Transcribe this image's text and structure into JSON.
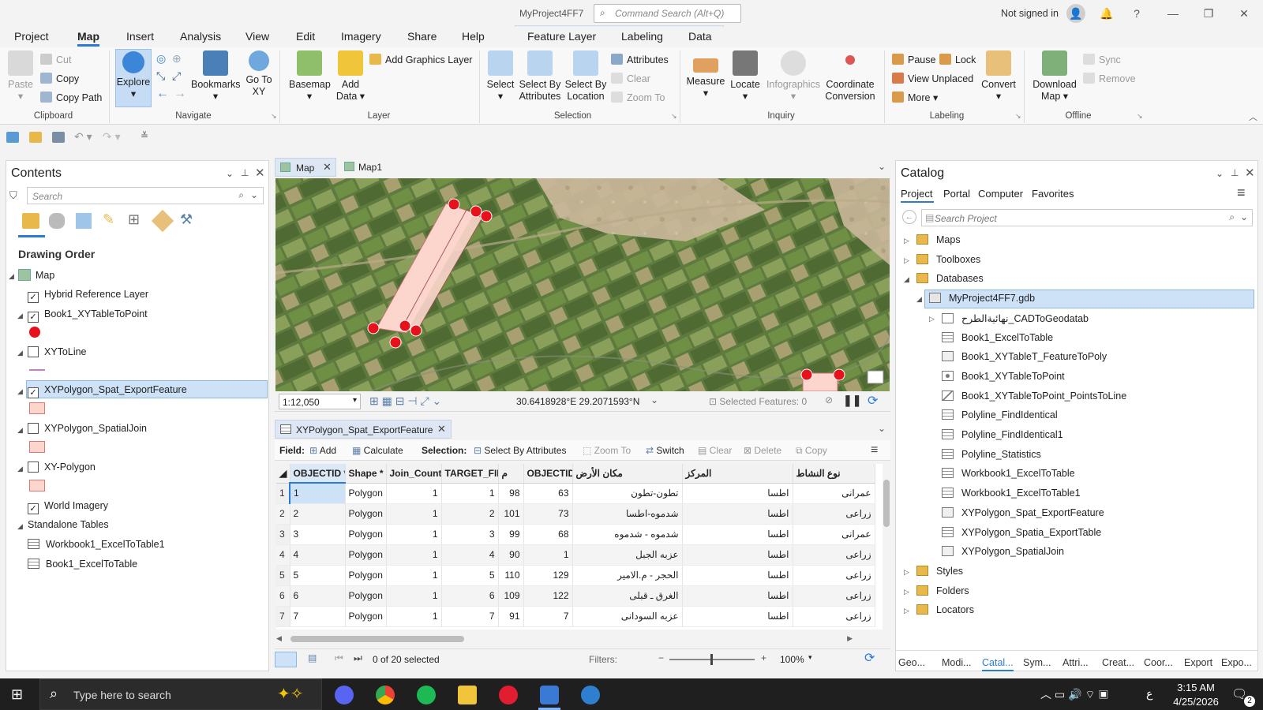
{
  "window": {
    "title": "MyProject4FF7",
    "command_search_placeholder": "Command Search (Alt+Q)",
    "signin": "Not signed in",
    "help": "?"
  },
  "menu_tabs": [
    "Project",
    "Map",
    "Insert",
    "Analysis",
    "View",
    "Edit",
    "Imagery",
    "Share",
    "Help"
  ],
  "context_tabs": [
    "Feature Layer",
    "Labeling",
    "Data"
  ],
  "ribbon": {
    "clipboard": {
      "paste": "Paste",
      "cut": "Cut",
      "copy": "Copy",
      "copy_path": "Copy Path",
      "label": "Clipboard"
    },
    "navigate": {
      "explore": "Explore",
      "bookmarks": "Bookmarks",
      "go_to_xy": "Go To XY",
      "label": "Navigate"
    },
    "layer": {
      "basemap": "Basemap",
      "add_data": "Add Data",
      "add_graphics": "Add Graphics Layer",
      "label": "Layer"
    },
    "selection": {
      "select": "Select",
      "by_attr": "Select By Attributes",
      "by_loc": "Select By Location",
      "attributes": "Attributes",
      "clear": "Clear",
      "zoom_to": "Zoom To",
      "label": "Selection"
    },
    "inquiry": {
      "measure": "Measure",
      "locate": "Locate",
      "infographics": "Infographics",
      "coord_conv": "Coordinate Conversion",
      "label": "Inquiry"
    },
    "labeling": {
      "pause": "Pause",
      "lock": "Lock",
      "view_unplaced": "View Unplaced",
      "more": "More",
      "convert": "Convert",
      "label": "Labeling"
    },
    "offline": {
      "download_map": "Download Map",
      "sync": "Sync",
      "remove": "Remove",
      "label": "Offline"
    }
  },
  "contents": {
    "title": "Contents",
    "search_placeholder": "Search",
    "drawing_order": "Drawing Order",
    "layers": [
      {
        "name": "Map"
      },
      {
        "name": "Hybrid Reference Layer",
        "checked": true
      },
      {
        "name": "Book1_XYTableToPoint",
        "checked": true
      },
      {
        "name": "XYToLine",
        "checked": false
      },
      {
        "name": "XYPolygon_Spat_ExportFeature",
        "checked": true
      },
      {
        "name": "XYPolygon_SpatialJoin",
        "checked": false
      },
      {
        "name": "XY-Polygon",
        "checked": false
      },
      {
        "name": "World Imagery",
        "checked": true
      },
      {
        "name": "Standalone Tables"
      },
      {
        "name": "Workbook1_ExcelToTable1"
      },
      {
        "name": "Book1_ExcelToTable"
      }
    ]
  },
  "map_tabs": [
    "Map",
    "Map1"
  ],
  "map_status": {
    "scale": "1:12,050",
    "coords": "30.6418928°E 29.2071593°N",
    "selected": "Selected Features: 0"
  },
  "table": {
    "tab_title": "XYPolygon_Spat_ExportFeature",
    "field_label": "Field:",
    "add": "Add",
    "calculate": "Calculate",
    "selection_label": "Selection:",
    "select_by_attr": "Select By Attributes",
    "zoom_to": "Zoom To",
    "switch": "Switch",
    "clear": "Clear",
    "delete": "Delete",
    "copy": "Copy",
    "columns": [
      "OBJECTID *",
      "Shape *",
      "Join_Count",
      "TARGET_FID",
      "م",
      "OBJECTID",
      "مكان الأرض",
      "المركز",
      "نوع النشاط"
    ],
    "rows": [
      [
        "1",
        "1",
        "Polygon",
        "1",
        "1",
        "98",
        "63",
        "تطون-تطون",
        "اطسا",
        "عمرانى"
      ],
      [
        "2",
        "2",
        "Polygon",
        "1",
        "2",
        "101",
        "73",
        "شدموه-اطسا",
        "اطسا",
        "زراعى"
      ],
      [
        "3",
        "3",
        "Polygon",
        "1",
        "3",
        "99",
        "68",
        "شدموه - شدموه",
        "اطسا",
        "عمرانى"
      ],
      [
        "4",
        "4",
        "Polygon",
        "1",
        "4",
        "90",
        "1",
        "عزبه الجبل",
        "اطسا",
        "زراعى"
      ],
      [
        "5",
        "5",
        "Polygon",
        "1",
        "5",
        "110",
        "129",
        "الحجر - م.الامير",
        "اطسا",
        "زراعى"
      ],
      [
        "6",
        "6",
        "Polygon",
        "1",
        "6",
        "109",
        "122",
        "الغرق ـ قبلى",
        "اطسا",
        "زراعى"
      ],
      [
        "7",
        "7",
        "Polygon",
        "1",
        "7",
        "91",
        "7",
        "عزبه السودانى",
        "اطسا",
        "زراعى"
      ]
    ],
    "status": "0 of 20 selected",
    "filters": "Filters:",
    "zoom": "100%"
  },
  "catalog": {
    "title": "Catalog",
    "tabs": [
      "Project",
      "Portal",
      "Computer",
      "Favorites"
    ],
    "search_placeholder": "Search Project",
    "items": [
      "Maps",
      "Toolboxes",
      "Databases",
      "MyProject4FF7.gdb",
      "نهائيةالطرح_CADToGeodatab",
      "Book1_ExcelToTable",
      "Book1_XYTableT_FeatureToPoly",
      "Book1_XYTableToPoint",
      "Book1_XYTableToPoint_PointsToLine",
      "Polyline_FindIdentical",
      "Polyline_FindIdentical1",
      "Polyline_Statistics",
      "Workbook1_ExcelToTable",
      "Workbook1_ExcelToTable1",
      "XYPolygon_Spat_ExportFeature",
      "XYPolygon_Spatia_ExportTable",
      "XYPolygon_SpatialJoin",
      "Styles",
      "Folders",
      "Locators"
    ],
    "bottom_tabs": [
      "Geo...",
      "Modi...",
      "Catal...",
      "Sym...",
      "Attri...",
      "Creat...",
      "Coor...",
      "Export",
      "Expo..."
    ]
  },
  "taskbar": {
    "search": "Type here to search",
    "time": "3:15 AM",
    "date": "4/25/2026",
    "lang": "ع",
    "notifications": "2"
  },
  "colors": {
    "accent": "#2b7bd6",
    "selection": "#cde1f7",
    "polygon_fill": "#fcd6cc",
    "point": "#e8101a"
  }
}
